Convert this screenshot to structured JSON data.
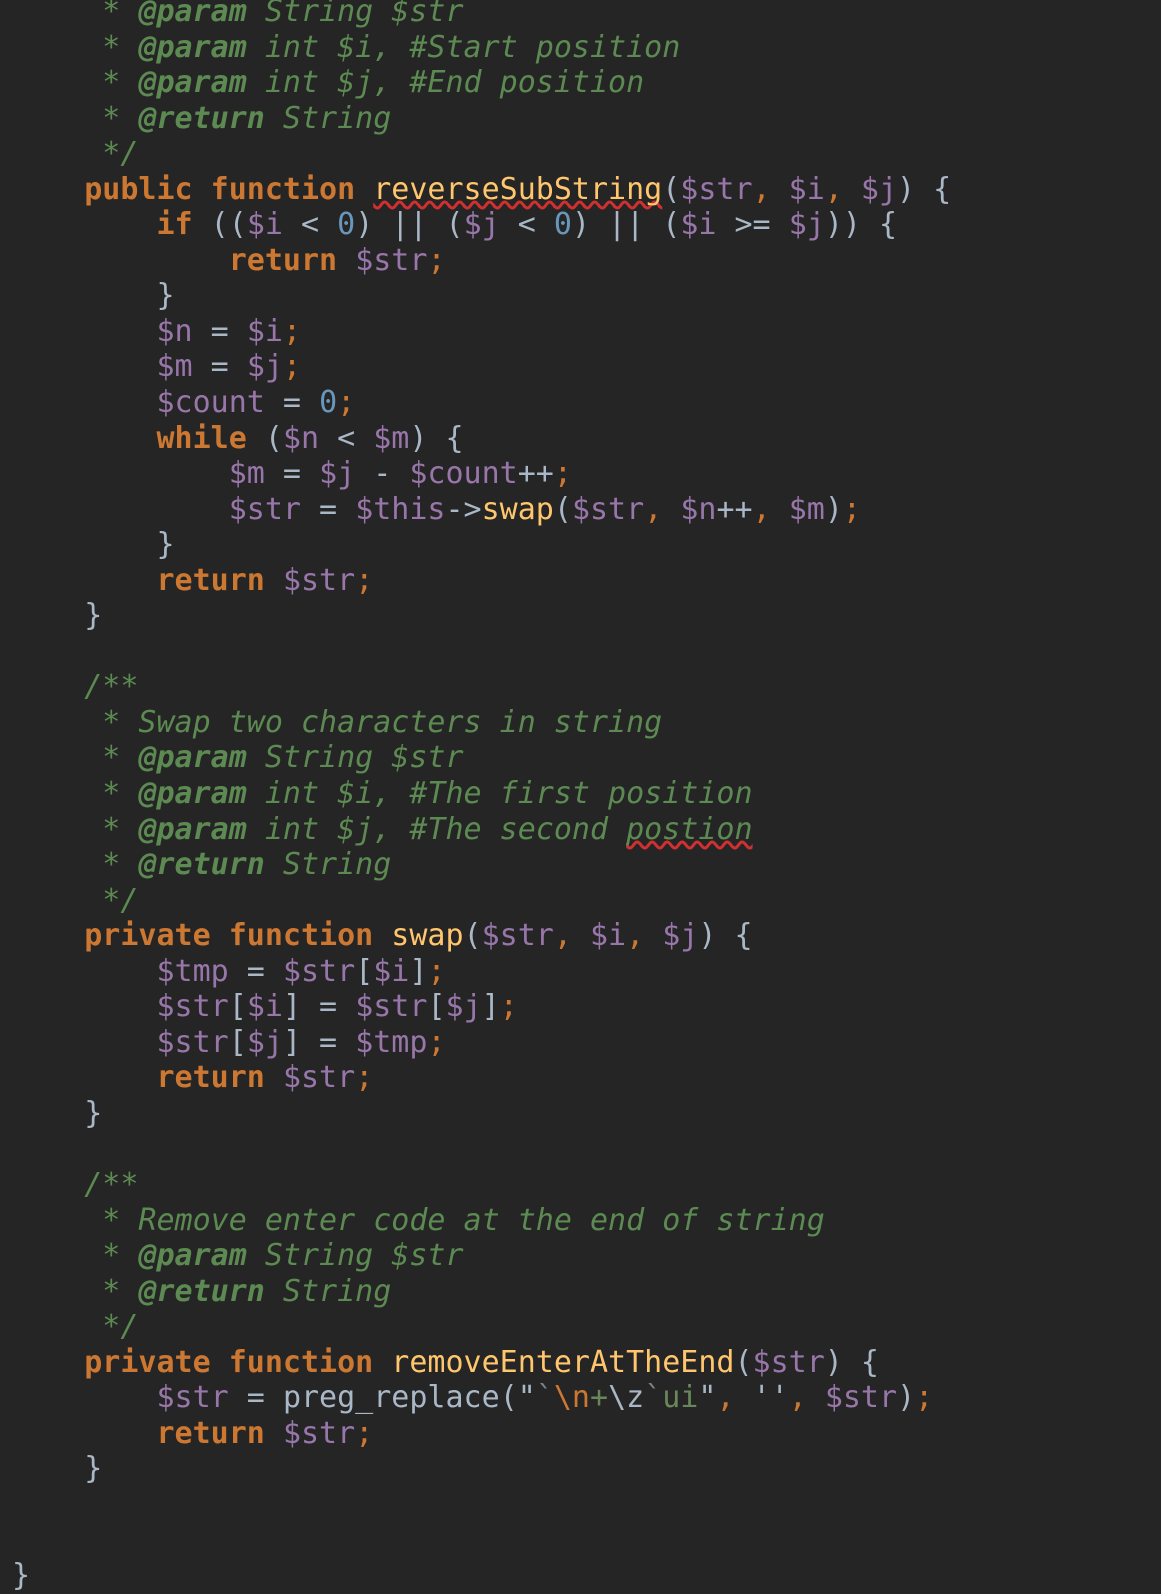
{
  "editor": {
    "language": "php",
    "theme": "darcula",
    "background": "#252525",
    "font_size_px": 30,
    "colors": {
      "comment": "#5c8a52",
      "keyword": "#cc7832",
      "variable": "#9876aa",
      "number": "#6897bb",
      "function": "#ffc66d",
      "plain": "#a9b7c6",
      "string_escape": "#cc7832",
      "string_literal": "#6a8759",
      "spell_error_underline": "#d03030"
    }
  },
  "code": {
    "lines": [
      {
        "indent": 1,
        "tokens": [
          {
            "t": "cmt",
            "v": " * "
          },
          {
            "t": "cmt-tag",
            "v": "@param"
          },
          {
            "t": "cmt",
            "v": " String $str"
          }
        ]
      },
      {
        "indent": 1,
        "tokens": [
          {
            "t": "cmt",
            "v": " * "
          },
          {
            "t": "cmt-tag",
            "v": "@param"
          },
          {
            "t": "cmt",
            "v": " int $i, #Start position"
          }
        ]
      },
      {
        "indent": 1,
        "tokens": [
          {
            "t": "cmt",
            "v": " * "
          },
          {
            "t": "cmt-tag",
            "v": "@param"
          },
          {
            "t": "cmt",
            "v": " int $j, #End position"
          }
        ]
      },
      {
        "indent": 1,
        "tokens": [
          {
            "t": "cmt",
            "v": " * "
          },
          {
            "t": "cmt-tag",
            "v": "@return"
          },
          {
            "t": "cmt",
            "v": " String"
          }
        ]
      },
      {
        "indent": 1,
        "tokens": [
          {
            "t": "cmt",
            "v": " */"
          }
        ]
      },
      {
        "indent": 1,
        "tokens": [
          {
            "t": "kw",
            "v": "public function"
          },
          {
            "t": "plain",
            "v": " "
          },
          {
            "t": "fn-dec typo",
            "v": "reverseSubString"
          },
          {
            "t": "plain",
            "v": "("
          },
          {
            "t": "var",
            "v": "$str"
          },
          {
            "t": "punc",
            "v": ","
          },
          {
            "t": "plain",
            "v": " "
          },
          {
            "t": "var",
            "v": "$i"
          },
          {
            "t": "punc",
            "v": ","
          },
          {
            "t": "plain",
            "v": " "
          },
          {
            "t": "var",
            "v": "$j"
          },
          {
            "t": "plain",
            "v": ") {"
          }
        ]
      },
      {
        "indent": 2,
        "tokens": [
          {
            "t": "kw",
            "v": "if"
          },
          {
            "t": "plain",
            "v": " (("
          },
          {
            "t": "var",
            "v": "$i"
          },
          {
            "t": "plain",
            "v": " < "
          },
          {
            "t": "num",
            "v": "0"
          },
          {
            "t": "plain",
            "v": ") || ("
          },
          {
            "t": "var",
            "v": "$j"
          },
          {
            "t": "plain",
            "v": " < "
          },
          {
            "t": "num",
            "v": "0"
          },
          {
            "t": "plain",
            "v": ") || ("
          },
          {
            "t": "var",
            "v": "$i"
          },
          {
            "t": "plain",
            "v": " >= "
          },
          {
            "t": "var",
            "v": "$j"
          },
          {
            "t": "plain",
            "v": ")) {"
          }
        ]
      },
      {
        "indent": 3,
        "tokens": [
          {
            "t": "kw",
            "v": "return"
          },
          {
            "t": "plain",
            "v": " "
          },
          {
            "t": "var",
            "v": "$str"
          },
          {
            "t": "punc",
            "v": ";"
          }
        ]
      },
      {
        "indent": 2,
        "tokens": [
          {
            "t": "plain",
            "v": "}"
          }
        ]
      },
      {
        "indent": 2,
        "tokens": [
          {
            "t": "var",
            "v": "$n"
          },
          {
            "t": "plain",
            "v": " = "
          },
          {
            "t": "var",
            "v": "$i"
          },
          {
            "t": "punc",
            "v": ";"
          }
        ]
      },
      {
        "indent": 2,
        "tokens": [
          {
            "t": "var",
            "v": "$m"
          },
          {
            "t": "plain",
            "v": " = "
          },
          {
            "t": "var",
            "v": "$j"
          },
          {
            "t": "punc",
            "v": ";"
          }
        ]
      },
      {
        "indent": 2,
        "tokens": [
          {
            "t": "var",
            "v": "$count"
          },
          {
            "t": "plain",
            "v": " = "
          },
          {
            "t": "num",
            "v": "0"
          },
          {
            "t": "punc",
            "v": ";"
          }
        ]
      },
      {
        "indent": 2,
        "tokens": [
          {
            "t": "kw",
            "v": "while"
          },
          {
            "t": "plain",
            "v": " ("
          },
          {
            "t": "var",
            "v": "$n"
          },
          {
            "t": "plain",
            "v": " < "
          },
          {
            "t": "var",
            "v": "$m"
          },
          {
            "t": "plain",
            "v": ") {"
          }
        ]
      },
      {
        "indent": 3,
        "tokens": [
          {
            "t": "var",
            "v": "$m"
          },
          {
            "t": "plain",
            "v": " = "
          },
          {
            "t": "var",
            "v": "$j"
          },
          {
            "t": "plain",
            "v": " - "
          },
          {
            "t": "var",
            "v": "$count"
          },
          {
            "t": "plain",
            "v": "++"
          },
          {
            "t": "punc",
            "v": ";"
          }
        ]
      },
      {
        "indent": 3,
        "tokens": [
          {
            "t": "var",
            "v": "$str"
          },
          {
            "t": "plain",
            "v": " = "
          },
          {
            "t": "var",
            "v": "$this"
          },
          {
            "t": "plain",
            "v": "->"
          },
          {
            "t": "fn",
            "v": "swap"
          },
          {
            "t": "plain",
            "v": "("
          },
          {
            "t": "var",
            "v": "$str"
          },
          {
            "t": "punc",
            "v": ","
          },
          {
            "t": "plain",
            "v": " "
          },
          {
            "t": "var",
            "v": "$n"
          },
          {
            "t": "plain",
            "v": "++"
          },
          {
            "t": "punc",
            "v": ","
          },
          {
            "t": "plain",
            "v": " "
          },
          {
            "t": "var",
            "v": "$m"
          },
          {
            "t": "plain",
            "v": ")"
          },
          {
            "t": "punc",
            "v": ";"
          }
        ]
      },
      {
        "indent": 2,
        "tokens": [
          {
            "t": "plain",
            "v": "}"
          }
        ]
      },
      {
        "indent": 2,
        "tokens": [
          {
            "t": "kw",
            "v": "return"
          },
          {
            "t": "plain",
            "v": " "
          },
          {
            "t": "var",
            "v": "$str"
          },
          {
            "t": "punc",
            "v": ";"
          }
        ]
      },
      {
        "indent": 1,
        "tokens": [
          {
            "t": "plain",
            "v": "}"
          }
        ]
      },
      {
        "indent": 0,
        "tokens": []
      },
      {
        "indent": 1,
        "tokens": [
          {
            "t": "cmt",
            "v": "/**"
          }
        ]
      },
      {
        "indent": 1,
        "tokens": [
          {
            "t": "cmt",
            "v": " * Swap two characters in string"
          }
        ]
      },
      {
        "indent": 1,
        "tokens": [
          {
            "t": "cmt",
            "v": " * "
          },
          {
            "t": "cmt-tag",
            "v": "@param"
          },
          {
            "t": "cmt",
            "v": " String $str"
          }
        ]
      },
      {
        "indent": 1,
        "tokens": [
          {
            "t": "cmt",
            "v": " * "
          },
          {
            "t": "cmt-tag",
            "v": "@param"
          },
          {
            "t": "cmt",
            "v": " int $i, #The first position"
          }
        ]
      },
      {
        "indent": 1,
        "tokens": [
          {
            "t": "cmt",
            "v": " * "
          },
          {
            "t": "cmt-tag",
            "v": "@param"
          },
          {
            "t": "cmt",
            "v": " int $j, #The second "
          },
          {
            "t": "cmt typo",
            "v": "postion"
          }
        ]
      },
      {
        "indent": 1,
        "tokens": [
          {
            "t": "cmt",
            "v": " * "
          },
          {
            "t": "cmt-tag",
            "v": "@return"
          },
          {
            "t": "cmt",
            "v": " String"
          }
        ]
      },
      {
        "indent": 1,
        "tokens": [
          {
            "t": "cmt",
            "v": " */"
          }
        ]
      },
      {
        "indent": 1,
        "tokens": [
          {
            "t": "kw",
            "v": "private function"
          },
          {
            "t": "plain",
            "v": " "
          },
          {
            "t": "fn",
            "v": "swap"
          },
          {
            "t": "plain",
            "v": "("
          },
          {
            "t": "var",
            "v": "$str"
          },
          {
            "t": "punc",
            "v": ","
          },
          {
            "t": "plain",
            "v": " "
          },
          {
            "t": "var",
            "v": "$i"
          },
          {
            "t": "punc",
            "v": ","
          },
          {
            "t": "plain",
            "v": " "
          },
          {
            "t": "var",
            "v": "$j"
          },
          {
            "t": "plain",
            "v": ") {"
          }
        ]
      },
      {
        "indent": 2,
        "tokens": [
          {
            "t": "var",
            "v": "$tmp"
          },
          {
            "t": "plain",
            "v": " = "
          },
          {
            "t": "var",
            "v": "$str"
          },
          {
            "t": "plain",
            "v": "["
          },
          {
            "t": "var",
            "v": "$i"
          },
          {
            "t": "plain",
            "v": "]"
          },
          {
            "t": "punc",
            "v": ";"
          }
        ]
      },
      {
        "indent": 2,
        "tokens": [
          {
            "t": "var",
            "v": "$str"
          },
          {
            "t": "plain",
            "v": "["
          },
          {
            "t": "var",
            "v": "$i"
          },
          {
            "t": "plain",
            "v": "] = "
          },
          {
            "t": "var",
            "v": "$str"
          },
          {
            "t": "plain",
            "v": "["
          },
          {
            "t": "var",
            "v": "$j"
          },
          {
            "t": "plain",
            "v": "]"
          },
          {
            "t": "punc",
            "v": ";"
          }
        ]
      },
      {
        "indent": 2,
        "tokens": [
          {
            "t": "var",
            "v": "$str"
          },
          {
            "t": "plain",
            "v": "["
          },
          {
            "t": "var",
            "v": "$j"
          },
          {
            "t": "plain",
            "v": "] = "
          },
          {
            "t": "var",
            "v": "$tmp"
          },
          {
            "t": "punc",
            "v": ";"
          }
        ]
      },
      {
        "indent": 2,
        "tokens": [
          {
            "t": "kw",
            "v": "return"
          },
          {
            "t": "plain",
            "v": " "
          },
          {
            "t": "var",
            "v": "$str"
          },
          {
            "t": "punc",
            "v": ";"
          }
        ]
      },
      {
        "indent": 1,
        "tokens": [
          {
            "t": "plain",
            "v": "}"
          }
        ]
      },
      {
        "indent": 0,
        "tokens": []
      },
      {
        "indent": 1,
        "tokens": [
          {
            "t": "cmt",
            "v": "/**"
          }
        ]
      },
      {
        "indent": 1,
        "tokens": [
          {
            "t": "cmt",
            "v": " * Remove enter code at the end of string"
          }
        ]
      },
      {
        "indent": 1,
        "tokens": [
          {
            "t": "cmt",
            "v": " * "
          },
          {
            "t": "cmt-tag",
            "v": "@param"
          },
          {
            "t": "cmt",
            "v": " String $str"
          }
        ]
      },
      {
        "indent": 1,
        "tokens": [
          {
            "t": "cmt",
            "v": " * "
          },
          {
            "t": "cmt-tag",
            "v": "@return"
          },
          {
            "t": "cmt",
            "v": " String"
          }
        ]
      },
      {
        "indent": 1,
        "tokens": [
          {
            "t": "cmt",
            "v": " */"
          }
        ]
      },
      {
        "indent": 1,
        "tokens": [
          {
            "t": "kw",
            "v": "private function"
          },
          {
            "t": "plain",
            "v": " "
          },
          {
            "t": "fn",
            "v": "removeEnterAtTheEnd"
          },
          {
            "t": "plain",
            "v": "("
          },
          {
            "t": "var",
            "v": "$str"
          },
          {
            "t": "plain",
            "v": ") {"
          }
        ]
      },
      {
        "indent": 2,
        "tokens": [
          {
            "t": "var",
            "v": "$str"
          },
          {
            "t": "plain",
            "v": " = "
          },
          {
            "t": "plain",
            "v": "preg_replace"
          },
          {
            "t": "plain",
            "v": "("
          },
          {
            "t": "str",
            "v": "\""
          },
          {
            "t": "str-gry",
            "v": "`"
          },
          {
            "t": "str-esc",
            "v": "\\n"
          },
          {
            "t": "str-grn",
            "v": "+"
          },
          {
            "t": "str",
            "v": "\\z"
          },
          {
            "t": "str-gry",
            "v": "`"
          },
          {
            "t": "str-grn",
            "v": "ui"
          },
          {
            "t": "str",
            "v": "\""
          },
          {
            "t": "punc",
            "v": ","
          },
          {
            "t": "plain",
            "v": " "
          },
          {
            "t": "str",
            "v": "''"
          },
          {
            "t": "punc",
            "v": ","
          },
          {
            "t": "plain",
            "v": " "
          },
          {
            "t": "var",
            "v": "$str"
          },
          {
            "t": "plain",
            "v": ")"
          },
          {
            "t": "punc",
            "v": ";"
          }
        ]
      },
      {
        "indent": 2,
        "tokens": [
          {
            "t": "kw",
            "v": "return"
          },
          {
            "t": "plain",
            "v": " "
          },
          {
            "t": "var",
            "v": "$str"
          },
          {
            "t": "punc",
            "v": ";"
          }
        ]
      },
      {
        "indent": 1,
        "tokens": [
          {
            "t": "plain",
            "v": "}"
          }
        ]
      },
      {
        "indent": 0,
        "tokens": []
      },
      {
        "indent": 0,
        "tokens": []
      },
      {
        "indent": 0,
        "tokens": [
          {
            "t": "plain",
            "v": "}"
          }
        ]
      }
    ]
  }
}
